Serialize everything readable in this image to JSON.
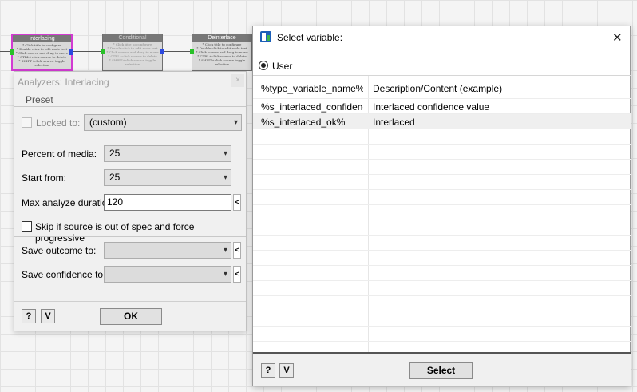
{
  "workflow": {
    "nodes": [
      {
        "title": "Interlacing",
        "lines": [
          "* Click title to configure",
          "* Double-click to edit node text",
          "* Click source and drag to move",
          "* CTRL+click source to delete",
          "* SHIFT+click source toggle selection"
        ]
      },
      {
        "title": "Conditional",
        "lines": [
          "* Click title to configure",
          "* Double-click to edit node text",
          "* Click source and drag to move",
          "* CTRL+click source to delete",
          "* SHIFT+click source toggle selection"
        ]
      },
      {
        "title": "Deinterlace",
        "lines": [
          "* Click title to configure",
          "* Double-click to edit node text",
          "* Click source and drag to move",
          "* CTRL+click source to delete",
          "* SHIFT+click source toggle selection"
        ]
      }
    ]
  },
  "analyzer_dialog": {
    "title": "Analyzers: Interlacing",
    "close_glyph": "×",
    "preset_label": "Preset",
    "locked_to_label": "Locked to:",
    "locked_to_value": "(custom)",
    "percent_label": "Percent of media:",
    "percent_value": "25",
    "start_label": "Start from:",
    "start_value": "25",
    "max_duration_label": "Max analyze duration:",
    "max_duration_value": "120",
    "skip_label": "Skip if source is out of spec and force progressive",
    "save_outcome_label": "Save outcome to:",
    "save_outcome_value": "",
    "save_confidence_label": "Save confidence to:",
    "save_confidence_value": "",
    "help_label": "?",
    "v_label": "V",
    "ok_label": "OK"
  },
  "variable_dialog": {
    "title": "Select variable:",
    "close_glyph": "✕",
    "radio_label": "User",
    "columns": {
      "name": "%type_variable_name%",
      "description": "Description/Content (example)"
    },
    "rows": [
      {
        "name": "%s_interlaced_confidence%",
        "description": "Interlaced confidence value"
      },
      {
        "name": "%s_interlaced_ok%",
        "description": "Interlaced"
      }
    ],
    "help_label": "?",
    "v_label": "V",
    "select_label": "Select"
  },
  "colors": {
    "accent_selected_node": "#d23ad2",
    "port_in": "#27c127",
    "port_out": "#2c49e0"
  },
  "icons": {
    "dropdown": "▾",
    "left_arrow": "<",
    "app": "app-icon"
  }
}
